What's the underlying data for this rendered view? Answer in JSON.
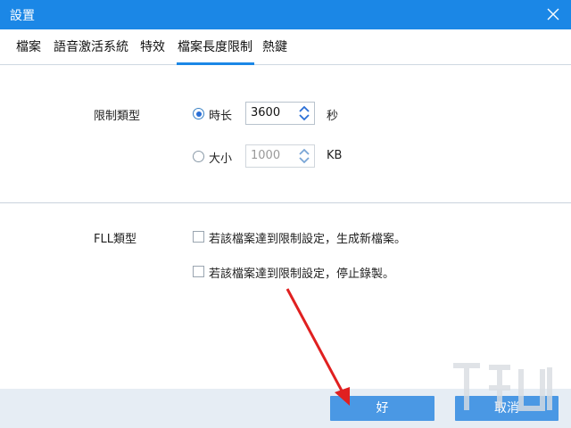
{
  "window": {
    "title": "設置"
  },
  "tabs": [
    {
      "label": "檔案"
    },
    {
      "label": "語音激活系統"
    },
    {
      "label": "特效"
    },
    {
      "label": "檔案長度限制"
    },
    {
      "label": "熱鍵"
    }
  ],
  "active_tab": "檔案長度限制",
  "limit_section": {
    "label": "限制類型",
    "options": [
      {
        "label": "時长",
        "value": "3600",
        "unit": "秒",
        "selected": true
      },
      {
        "label": "大小",
        "value": "1000",
        "unit": "KB",
        "selected": false
      }
    ]
  },
  "fll_section": {
    "label": "FLL類型",
    "options": [
      {
        "label": "若該檔案達到限制設定，生成新檔案。",
        "checked": false
      },
      {
        "label": "若該檔案達到限制設定，停止錄製。",
        "checked": false
      }
    ]
  },
  "footer": {
    "ok_label": "好",
    "cancel_label": "取消"
  },
  "colors": {
    "accent": "#1b87e6",
    "button": "#4a98e4",
    "footer_bg": "#e6edf4",
    "annotation_arrow": "#e02020"
  }
}
